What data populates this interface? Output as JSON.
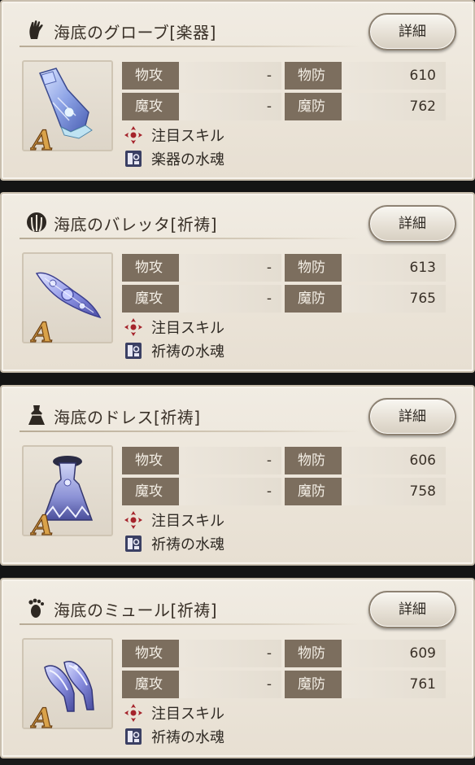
{
  "colors": {
    "card_background": "#ebe4d8",
    "stat_label_background": "#7c6e5e",
    "stat_label_text": "#f4efe6",
    "text": "#3a3128",
    "skill_icon": "#a5232b",
    "soul_icon": "#3a3f63"
  },
  "detail_label": "詳細",
  "stat_labels": {
    "patk": "物攻",
    "pdef": "物防",
    "matk": "魔攻",
    "mdef": "魔防"
  },
  "featured_skill_label": "注目スキル",
  "items": [
    {
      "title": "海底のグローブ[楽器]",
      "slot_icon": "glove-icon",
      "rank": "A",
      "patk": "-",
      "pdef": "610",
      "matk": "-",
      "mdef": "762",
      "soul": "楽器の水魂"
    },
    {
      "title": "海底のバレッタ[祈祷]",
      "slot_icon": "hair-accessory-icon",
      "rank": "A",
      "patk": "-",
      "pdef": "613",
      "matk": "-",
      "mdef": "765",
      "soul": "祈祷の水魂"
    },
    {
      "title": "海底のドレス[祈祷]",
      "slot_icon": "dress-icon",
      "rank": "A",
      "patk": "-",
      "pdef": "606",
      "matk": "-",
      "mdef": "758",
      "soul": "祈祷の水魂"
    },
    {
      "title": "海底のミュール[祈祷]",
      "slot_icon": "footprint-icon",
      "rank": "A",
      "patk": "-",
      "pdef": "609",
      "matk": "-",
      "mdef": "761",
      "soul": "祈祷の水魂"
    }
  ]
}
